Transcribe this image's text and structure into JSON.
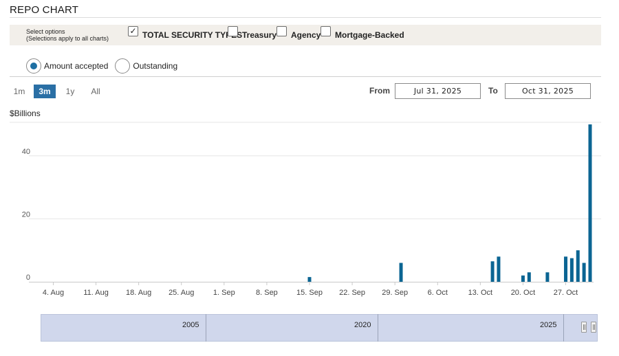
{
  "header": {
    "title": "REPO CHART"
  },
  "options": {
    "label_line1": "Select options",
    "label_line2": "(Selections apply to all charts)",
    "checkboxes": [
      {
        "label": "TOTAL SECURITY TYPES",
        "checked": true
      },
      {
        "label": "Treasury",
        "checked": false
      },
      {
        "label": "Agency",
        "checked": false
      },
      {
        "label": "Mortgage-Backed",
        "checked": false
      }
    ]
  },
  "radios": [
    {
      "label": "Amount accepted",
      "checked": true
    },
    {
      "label": "Outstanding",
      "checked": false
    }
  ],
  "range_buttons": [
    {
      "label": "1m",
      "active": false
    },
    {
      "label": "3m",
      "active": true
    },
    {
      "label": "1y",
      "active": false
    },
    {
      "label": "All",
      "active": false
    }
  ],
  "date_range": {
    "from_label": "From",
    "from_value": "Jul 31, 2025",
    "to_label": "To",
    "to_value": "Oct 31, 2025"
  },
  "navigator": {
    "labels": [
      "2005",
      "2020",
      "2025"
    ]
  },
  "colors": {
    "bar": "#0b6593",
    "accent": "#2a6fa5",
    "navigator": "#d0d7ec"
  },
  "chart_data": {
    "type": "bar",
    "ylabel": "$Billions",
    "ylim": [
      0,
      50
    ],
    "yticks": [
      0,
      20,
      40
    ],
    "xlim": [
      "2025-07-31",
      "2025-10-31"
    ],
    "x_ticks": [
      {
        "label": "4. Aug",
        "date": "2025-08-04"
      },
      {
        "label": "11. Aug",
        "date": "2025-08-11"
      },
      {
        "label": "18. Aug",
        "date": "2025-08-18"
      },
      {
        "label": "25. Aug",
        "date": "2025-08-25"
      },
      {
        "label": "1. Sep",
        "date": "2025-09-01"
      },
      {
        "label": "8. Sep",
        "date": "2025-09-08"
      },
      {
        "label": "15. Sep",
        "date": "2025-09-15"
      },
      {
        "label": "22. Sep",
        "date": "2025-09-22"
      },
      {
        "label": "29. Sep",
        "date": "2025-09-29"
      },
      {
        "label": "6. Oct",
        "date": "2025-10-06"
      },
      {
        "label": "13. Oct",
        "date": "2025-10-13"
      },
      {
        "label": "20. Oct",
        "date": "2025-10-20"
      },
      {
        "label": "27. Oct",
        "date": "2025-10-27"
      }
    ],
    "grid": true,
    "series": [
      {
        "points": [
          {
            "date": "2025-09-15",
            "value": 1.5
          },
          {
            "date": "2025-09-30",
            "value": 6
          },
          {
            "date": "2025-10-15",
            "value": 6.5
          },
          {
            "date": "2025-10-16",
            "value": 8
          },
          {
            "date": "2025-10-20",
            "value": 2
          },
          {
            "date": "2025-10-21",
            "value": 3
          },
          {
            "date": "2025-10-24",
            "value": 3
          },
          {
            "date": "2025-10-27",
            "value": 8
          },
          {
            "date": "2025-10-28",
            "value": 7.5
          },
          {
            "date": "2025-10-29",
            "value": 10
          },
          {
            "date": "2025-10-30",
            "value": 6
          },
          {
            "date": "2025-10-31",
            "value": 50
          }
        ]
      }
    ]
  }
}
